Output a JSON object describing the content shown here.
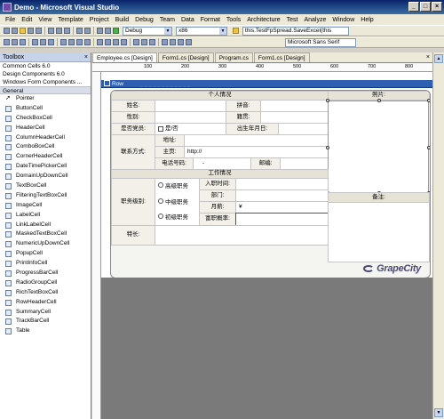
{
  "window": {
    "title": "Demo - Microsoft Visual Studio"
  },
  "menu": [
    "File",
    "Edit",
    "View",
    "Template",
    "Project",
    "Build",
    "Debug",
    "Team",
    "Data",
    "Format",
    "Tools",
    "Architecture",
    "Test",
    "Analyze",
    "Window",
    "Help"
  ],
  "toolbar": {
    "config": "Debug",
    "platform": "x86",
    "method_box": "this.TestFpSpread.SaveExcel(this",
    "font_box": "Microsoft Sans Serif"
  },
  "toolbox": {
    "title": "Toolbox",
    "close": "×",
    "categories": [
      "Common Cells 6.0",
      "Design Components 6.0",
      "Windows Form Components ..."
    ],
    "open_category": "General",
    "items": [
      "Pointer",
      "ButtonCell",
      "CheckBoxCell",
      "HeaderCell",
      "ColumnHeaderCell",
      "ComboBoxCell",
      "CornerHeaderCell",
      "DateTimePickerCell",
      "DomainUpDownCell",
      "TextBoxCell",
      "FilteringTextBoxCell",
      "ImageCell",
      "LabelCell",
      "LinkLabelCell",
      "MaskedTextBoxCell",
      "NumericUpDownCell",
      "PopupCell",
      "PrintInfoCell",
      "ProgressBarCell",
      "RadioGroupCell",
      "RichTextBoxCell",
      "RowHeaderCell",
      "SummaryCell",
      "TrackBarCell",
      "Table"
    ]
  },
  "tabs": [
    "Employee.cs [Design]",
    "Form1.cs [Design]",
    "Program.cs",
    "Form1.cs [Design]"
  ],
  "ruler": [
    "100",
    "200",
    "300",
    "400",
    "500",
    "600",
    "700",
    "800"
  ],
  "row_label": "Row",
  "form": {
    "section_personal": "个人情况",
    "photo": "照片:",
    "name": "姓名:",
    "gender": "性别:",
    "party": "是否党员:",
    "party_value": "是/否",
    "pinyin": "拼音:",
    "native": "籍贯:",
    "birthday": "出生年月日:",
    "contact": "联系方式:",
    "address": "地址:",
    "homepage": "主页:",
    "homepage_value": "http://",
    "phone": "电话号码:",
    "phone_value": "-",
    "zip": "邮编:",
    "section_work": "工作情况",
    "remark": "备注:",
    "level": "职务级别:",
    "level_high": "高级职务",
    "level_mid": "中级职务",
    "level_low": "初级职务",
    "join_date": "入职时间:",
    "department": "部门:",
    "salary": "月薪:",
    "salary_value": "¥",
    "rating": "富职概率:",
    "specialty": "特长:"
  },
  "logo": "GrapeCity"
}
